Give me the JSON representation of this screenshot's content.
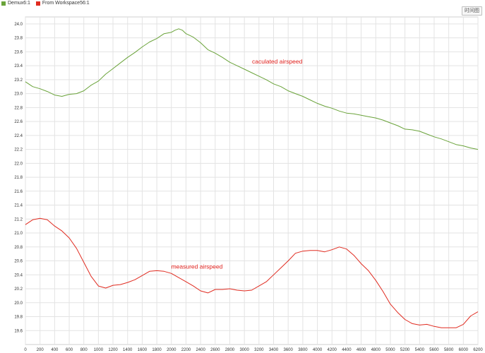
{
  "legend": [
    {
      "label": "Demux6:1",
      "color": "#6aa33a"
    },
    {
      "label": "From Workspace56:1",
      "color": "#e02b20"
    }
  ],
  "time_button": "时间图",
  "chart_data": {
    "type": "line",
    "title": "",
    "xlabel": "",
    "ylabel": "",
    "xlim": [
      0,
      6200
    ],
    "ylim": [
      19.4,
      24.1
    ],
    "xticks": [
      0,
      200,
      400,
      600,
      800,
      1000,
      1200,
      1400,
      1600,
      1800,
      2000,
      2200,
      2400,
      2600,
      2800,
      3000,
      3200,
      3400,
      3600,
      3800,
      4000,
      4200,
      4400,
      4600,
      4800,
      5000,
      5200,
      5400,
      5600,
      5800,
      6000,
      6200
    ],
    "yticks": [
      19.6,
      19.8,
      20.0,
      20.2,
      20.4,
      20.6,
      20.8,
      21.0,
      21.2,
      21.4,
      21.6,
      21.8,
      22.0,
      22.2,
      22.4,
      22.6,
      22.8,
      23.0,
      23.2,
      23.4,
      23.6,
      23.8,
      24.0
    ],
    "grid": true,
    "legend_position": "top-left",
    "series": [
      {
        "name": "Demux6:1",
        "color": "#6aa33a",
        "x": [
          0,
          100,
          200,
          300,
          400,
          500,
          600,
          700,
          800,
          900,
          1000,
          1100,
          1200,
          1300,
          1400,
          1500,
          1600,
          1700,
          1800,
          1900,
          2000,
          2050,
          2100,
          2150,
          2200,
          2300,
          2400,
          2500,
          2600,
          2700,
          2800,
          2900,
          3000,
          3100,
          3200,
          3300,
          3400,
          3500,
          3600,
          3700,
          3800,
          3900,
          4000,
          4100,
          4200,
          4300,
          4400,
          4500,
          4600,
          4700,
          4800,
          4900,
          5000,
          5100,
          5200,
          5300,
          5400,
          5500,
          5600,
          5700,
          5800,
          5900,
          6000,
          6100,
          6200
        ],
        "y": [
          23.17,
          23.1,
          23.07,
          23.03,
          22.98,
          22.96,
          22.99,
          23.0,
          23.04,
          23.12,
          23.18,
          23.28,
          23.36,
          23.44,
          23.52,
          23.59,
          23.67,
          23.74,
          23.79,
          23.86,
          23.88,
          23.91,
          23.93,
          23.91,
          23.86,
          23.81,
          23.73,
          23.63,
          23.58,
          23.52,
          23.45,
          23.4,
          23.35,
          23.3,
          23.25,
          23.2,
          23.14,
          23.1,
          23.04,
          23.0,
          22.96,
          22.91,
          22.86,
          22.82,
          22.79,
          22.75,
          22.72,
          22.71,
          22.69,
          22.67,
          22.65,
          22.62,
          22.58,
          22.54,
          22.49,
          22.48,
          22.46,
          22.42,
          22.38,
          22.35,
          22.31,
          22.27,
          22.25,
          22.22,
          22.2
        ]
      },
      {
        "name": "From Workspace56:1",
        "color": "#e02b20",
        "x": [
          0,
          100,
          200,
          300,
          400,
          500,
          600,
          700,
          800,
          900,
          1000,
          1100,
          1200,
          1300,
          1400,
          1500,
          1600,
          1700,
          1800,
          1900,
          2000,
          2100,
          2200,
          2300,
          2400,
          2500,
          2600,
          2700,
          2800,
          2900,
          3000,
          3100,
          3200,
          3300,
          3400,
          3500,
          3600,
          3700,
          3800,
          3900,
          4000,
          4100,
          4200,
          4300,
          4400,
          4500,
          4600,
          4700,
          4800,
          4900,
          5000,
          5100,
          5200,
          5300,
          5400,
          5500,
          5600,
          5700,
          5800,
          5900,
          6000,
          6100,
          6200
        ],
        "y": [
          21.12,
          21.19,
          21.21,
          21.19,
          21.1,
          21.03,
          20.93,
          20.78,
          20.58,
          20.38,
          20.24,
          20.21,
          20.25,
          20.26,
          20.29,
          20.33,
          20.39,
          20.45,
          20.46,
          20.45,
          20.42,
          20.36,
          20.3,
          20.24,
          20.17,
          20.14,
          20.19,
          20.19,
          20.2,
          20.18,
          20.17,
          20.18,
          20.24,
          20.3,
          20.4,
          20.5,
          20.6,
          20.71,
          20.74,
          20.75,
          20.75,
          20.73,
          20.76,
          20.8,
          20.77,
          20.68,
          20.56,
          20.46,
          20.32,
          20.16,
          19.98,
          19.86,
          19.76,
          19.7,
          19.68,
          19.69,
          19.66,
          19.64,
          19.64,
          19.64,
          19.69,
          19.81,
          19.87
        ]
      }
    ],
    "annotations": [
      {
        "text": "caculated airspeed",
        "x": 3450,
        "y": 23.43
      },
      {
        "text": "measured airspeed",
        "x": 2350,
        "y": 20.49
      }
    ]
  }
}
